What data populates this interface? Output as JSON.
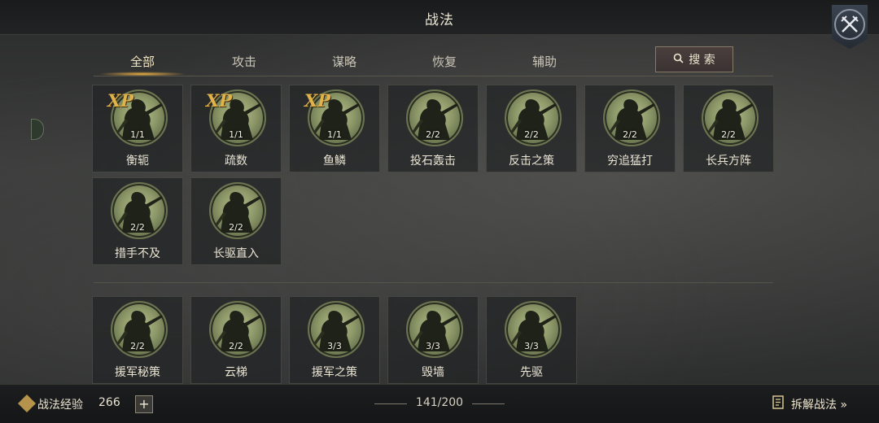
{
  "header": {
    "title": "战法"
  },
  "tabs": [
    {
      "label": "全部",
      "active": true
    },
    {
      "label": "攻击",
      "active": false
    },
    {
      "label": "谋略",
      "active": false
    },
    {
      "label": "恢复",
      "active": false
    },
    {
      "label": "辅助",
      "active": false
    }
  ],
  "search": {
    "label": "搜 索"
  },
  "tactics_top": [
    {
      "name": "衡轭",
      "count": "1/1",
      "xp": "XP"
    },
    {
      "name": "疏数",
      "count": "1/1",
      "xp": "XP"
    },
    {
      "name": "鱼鳞",
      "count": "1/1",
      "xp": "XP"
    },
    {
      "name": "投石轰击",
      "count": "2/2",
      "xp": ""
    },
    {
      "name": "反击之策",
      "count": "2/2",
      "xp": ""
    },
    {
      "name": "穷追猛打",
      "count": "2/2",
      "xp": ""
    },
    {
      "name": "长兵方阵",
      "count": "2/2",
      "xp": ""
    },
    {
      "name": "措手不及",
      "count": "2/2",
      "xp": ""
    },
    {
      "name": "长驱直入",
      "count": "2/2",
      "xp": ""
    }
  ],
  "tactics_bottom": [
    {
      "name": "援军秘策",
      "count": "2/2",
      "xp": ""
    },
    {
      "name": "云梯",
      "count": "2/2",
      "xp": ""
    },
    {
      "name": "援军之策",
      "count": "3/3",
      "xp": ""
    },
    {
      "name": "毁墙",
      "count": "3/3",
      "xp": ""
    },
    {
      "name": "先驱",
      "count": "3/3",
      "xp": ""
    }
  ],
  "footer": {
    "exp_label": "战法经验",
    "exp_value": "266",
    "plus": "+",
    "capacity": "141/200",
    "decompose_label": "拆解战法 »"
  },
  "icons": {
    "close": "crossed-swords-icon",
    "search": "search-icon",
    "exp": "exp-badge-icon",
    "decompose": "list-icon"
  }
}
